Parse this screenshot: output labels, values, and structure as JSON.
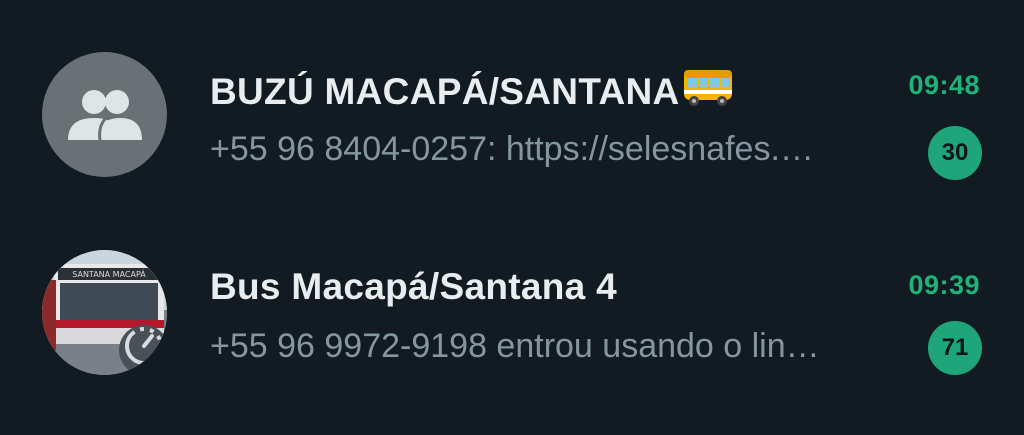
{
  "colors": {
    "background": "#111b21",
    "accent_time": "#1fb37a",
    "badge": "#1ea67a",
    "title": "#e9edef",
    "preview": "#8696a0"
  },
  "chats": [
    {
      "title": "BUZÚ MACAPÁ/SANTANA",
      "title_emoji": "bus-emoji",
      "avatar_icon": "group-icon",
      "time": "09:48",
      "preview": "+55 96 8404-0257: https://selesnafes.…",
      "unread": "30"
    },
    {
      "title": "Bus Macapá/Santana 4",
      "avatar_icon": "bus-photo",
      "status_icon": "disappearing-timer-icon",
      "time": "09:39",
      "preview": "+55 96 9972-9198 entrou usando o lin…",
      "unread": "71"
    }
  ]
}
